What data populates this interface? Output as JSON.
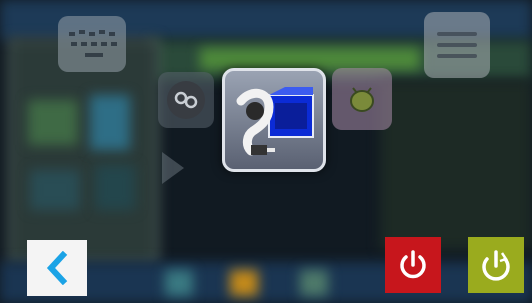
{
  "launcher": {
    "tiles": [
      {
        "name": "grid-app",
        "icon": "keyboard-grid-icon"
      },
      {
        "name": "link-app",
        "icon": "link-icon"
      },
      {
        "name": "selected-app",
        "icon": "network-drive-icon"
      },
      {
        "name": "bug-app",
        "icon": "bug-icon"
      },
      {
        "name": "list-app",
        "icon": "list-icon"
      }
    ]
  },
  "controls": {
    "back": {
      "icon": "chevron-left-icon",
      "color": "#1ba3e6"
    },
    "power": {
      "icon": "power-icon",
      "color": "#c7161c"
    },
    "restart": {
      "icon": "restart-power-icon",
      "color": "#9aab1e"
    }
  },
  "colors": {
    "taskbar": "#1a3552",
    "selected_tile_border": "#dfe3ea"
  }
}
